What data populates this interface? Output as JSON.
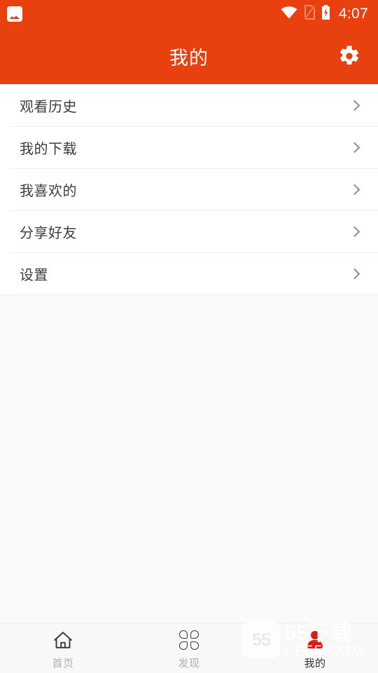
{
  "status_bar": {
    "left_icon": "photo-icon",
    "icons": [
      "wifi-icon",
      "sim-missing-icon",
      "battery-charging-icon"
    ],
    "time": "4:07"
  },
  "header": {
    "title": "我的",
    "action_icon": "gear-icon"
  },
  "menu": {
    "items": [
      {
        "label": "观看历史",
        "chevron": "chevron-right-icon"
      },
      {
        "label": "我的下载",
        "chevron": "chevron-right-icon"
      },
      {
        "label": "我喜欢的",
        "chevron": "chevron-right-icon"
      },
      {
        "label": "分享好友",
        "chevron": "chevron-right-icon"
      },
      {
        "label": "设置",
        "chevron": "chevron-right-icon"
      }
    ]
  },
  "bottom_nav": {
    "items": [
      {
        "label": "首页",
        "icon": "home-icon",
        "active": false
      },
      {
        "label": "发现",
        "icon": "clover-grid-icon",
        "active": false
      },
      {
        "label": "我的",
        "icon": "person-icon",
        "active": true
      }
    ]
  },
  "watermark": {
    "badge": "55",
    "main": "55下载",
    "sub": "PP55.COM"
  },
  "colors": {
    "accent": "#E8400F",
    "page_bg": "#FAFAFA",
    "card_bg": "#FFFFFF",
    "divider": "#EDEDED",
    "text_primary": "#3C3C3C",
    "nav_inactive": "#AFAFAF",
    "nav_active": "#333333",
    "person_red": "#D91E18"
  }
}
